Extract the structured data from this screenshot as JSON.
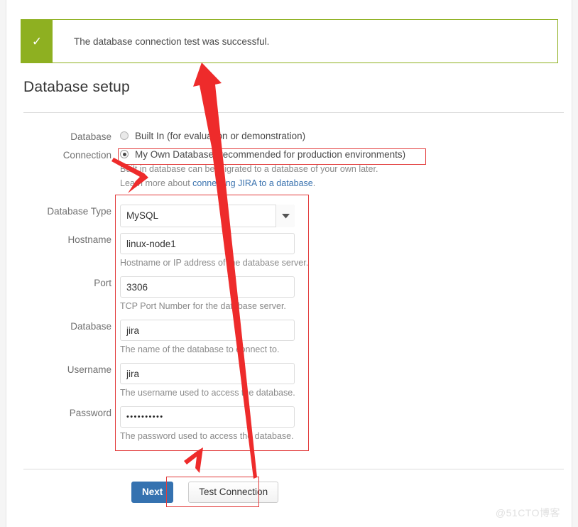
{
  "banner": {
    "icon": "check-icon",
    "message": "The database connection test was successful.",
    "accent_color": "#8eb021"
  },
  "page": {
    "title": "Database setup"
  },
  "form": {
    "connection": {
      "label": "Database\nConnection",
      "label_line1": "Database",
      "label_line2": "Connection",
      "options": [
        {
          "label": "Built In (for evaluation or demonstration)",
          "selected": false
        },
        {
          "label": "My Own Database (recommended for production environments)",
          "selected": true
        }
      ],
      "helper_line1": "Built in database can be migrated to a database of your own later.",
      "helper_line2_prefix": "Learn more about ",
      "helper_line2_link": "connecting JIRA to a database",
      "helper_line2_suffix": "."
    },
    "fields": [
      {
        "label": "Database Type",
        "type": "select",
        "value": "MySQL",
        "help": ""
      },
      {
        "label": "Hostname",
        "type": "text",
        "value": "linux-node1",
        "help": "Hostname or IP address of the database server."
      },
      {
        "label": "Port",
        "type": "text",
        "value": "3306",
        "help": "TCP Port Number for the database server."
      },
      {
        "label": "Database",
        "type": "text",
        "value": "jira",
        "help": "The name of the database to connect to."
      },
      {
        "label": "Username",
        "type": "text",
        "value": "jira",
        "help": "The username used to access the database."
      },
      {
        "label": "Password",
        "type": "password",
        "value": "••••••••••",
        "help": "The password used to access the database."
      }
    ]
  },
  "buttons": {
    "next": "Next",
    "test_connection": "Test Connection",
    "primary_color": "#3572b0"
  },
  "annotation": {
    "color": "#e23b3b"
  },
  "watermark": "@51CTO博客"
}
